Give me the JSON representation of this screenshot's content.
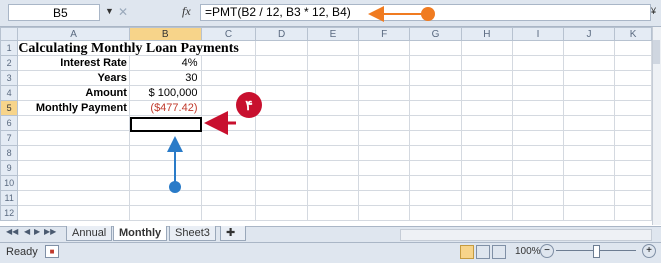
{
  "formula_bar": {
    "name_box": "B5",
    "fx": "fx",
    "formula": "=PMT(B2 / 12, B3 * 12, B4)"
  },
  "columns": [
    "A",
    "B",
    "C",
    "D",
    "E",
    "F",
    "G",
    "H",
    "I",
    "J",
    "K"
  ],
  "row_numbers": [
    "1",
    "2",
    "3",
    "4",
    "5",
    "6",
    "7",
    "8",
    "9",
    "10",
    "11",
    "12"
  ],
  "cells": {
    "title": "Calculating Monthly Loan Payments",
    "interest_label": "Interest Rate",
    "interest_value": "4%",
    "years_label": "Years",
    "years_value": "30",
    "amount_label": "Amount",
    "amount_value": "$ 100,000",
    "payment_label": "Monthly Payment",
    "payment_value": "($477.42)"
  },
  "selected_cell": "B5",
  "sheet_tabs": [
    "Annual",
    "Monthly",
    "Sheet3"
  ],
  "active_tab": "Monthly",
  "status": {
    "ready": "Ready",
    "zoom": "100%",
    "zoom_minus": "−",
    "zoom_plus": "+"
  },
  "annotation": {
    "badge": "۴",
    "arrow_color": "#c8102e",
    "formula_arrow_color": "#f07b20",
    "cell_arrow_color": "#2a7bc8"
  }
}
